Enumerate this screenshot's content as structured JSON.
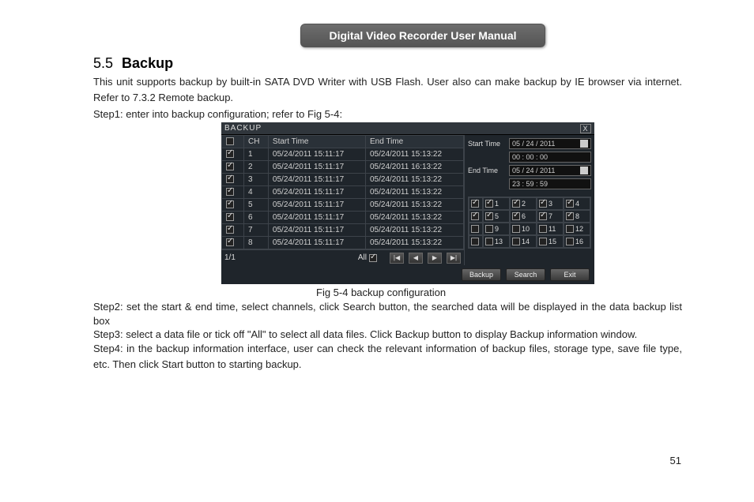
{
  "doc": {
    "banner": "Digital Video Recorder User Manual",
    "section_number": "5.5",
    "section_title": "Backup",
    "para1": "This unit supports backup by built-in SATA DVD Writer with USB Flash. User also can make backup by IE browser via internet. Refer to 7.3.2 Remote backup.",
    "step1": "Step1: enter into backup configuration; refer to Fig 5-4:",
    "figcaption": "Fig 5-4 backup configuration",
    "step2": "Step2: set the start & end time, select channels, click Search button, the searched data will be displayed in the data backup list box",
    "step3": "Step3: select a data file or tick off \"All\" to select all data files. Click Backup button to display Backup information window.",
    "step4": "Step4: in the backup information interface, user can check the relevant information of backup files, storage type, save file type, etc. Then click Start button to starting backup.",
    "page_number": "51"
  },
  "dvr": {
    "title": "BACKUP",
    "close": "X",
    "columns": {
      "ch": "CH",
      "start": "Start Time",
      "end": "End Time"
    },
    "rows": [
      {
        "ch": "1",
        "start": "05/24/2011 15:11:17",
        "end": "05/24/2011 15:13:22"
      },
      {
        "ch": "2",
        "start": "05/24/2011 15:11:17",
        "end": "05/24/2011 16:13:22"
      },
      {
        "ch": "3",
        "start": "05/24/2011 15:11:17",
        "end": "05/24/2011 15:13:22"
      },
      {
        "ch": "4",
        "start": "05/24/2011 15:11:17",
        "end": "05/24/2011 15:13:22"
      },
      {
        "ch": "5",
        "start": "05/24/2011 15:11:17",
        "end": "05/24/2011 15:13:22"
      },
      {
        "ch": "6",
        "start": "05/24/2011 15:11:17",
        "end": "05/24/2011 15:13:22"
      },
      {
        "ch": "7",
        "start": "05/24/2011 15:11:17",
        "end": "05/24/2011 15:13:22"
      },
      {
        "ch": "8",
        "start": "05/24/2011 15:11:17",
        "end": "05/24/2011 15:13:22"
      }
    ],
    "pager": {
      "counter": "1/1",
      "all_label": "All",
      "first": "|◀",
      "prev": "◀",
      "next": "▶",
      "last": "▶|"
    },
    "right": {
      "start_label": "Start Time",
      "end_label": "End Time",
      "start_date": "05 / 24 / 2011",
      "start_time": "00 : 00 : 00",
      "end_date": "05 / 24 / 2011",
      "end_time": "23 : 59 : 59"
    },
    "channels": [
      "1",
      "2",
      "3",
      "4",
      "5",
      "6",
      "7",
      "8",
      "9",
      "10",
      "11",
      "12",
      "13",
      "14",
      "15",
      "16"
    ],
    "channels_checked": [
      true,
      true,
      true,
      true,
      true,
      true,
      true,
      true,
      false,
      false,
      false,
      false,
      false,
      false,
      false,
      false
    ],
    "row_master_checked": [
      true,
      true,
      false,
      false
    ],
    "buttons": {
      "backup": "Backup",
      "search": "Search",
      "exit": "Exit"
    }
  }
}
